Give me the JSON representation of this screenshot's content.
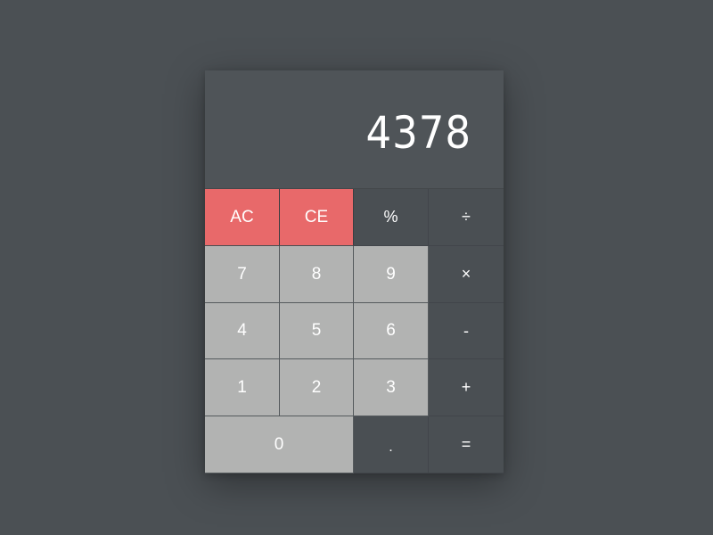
{
  "display": {
    "value": "4378"
  },
  "keys": {
    "ac": "AC",
    "ce": "CE",
    "percent": "%",
    "divide": "÷",
    "seven": "7",
    "eight": "8",
    "nine": "9",
    "multiply": "×",
    "four": "4",
    "five": "5",
    "six": "6",
    "subtract": "-",
    "one": "1",
    "two": "2",
    "three": "3",
    "add": "+",
    "zero": "0",
    "decimal": ".",
    "equals": "="
  },
  "colors": {
    "background": "#4b5054",
    "display": "#4f5458",
    "clear_keys": "#e8696a",
    "number_keys": "#b2b3b2",
    "operator_keys": "#4a4f53",
    "text": "#ffffff"
  }
}
